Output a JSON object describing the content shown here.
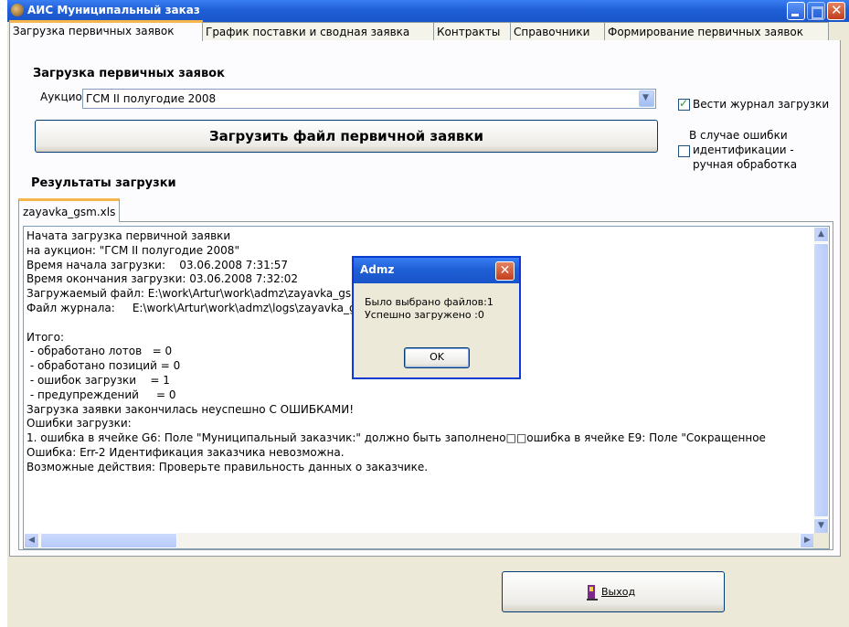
{
  "window": {
    "title": "АИС Муниципальный заказ"
  },
  "tabs": [
    {
      "label": "Загрузка первичных заявок",
      "active": true
    },
    {
      "label": "График поставки и сводная заявка",
      "active": false
    },
    {
      "label": "Контракты",
      "active": false
    },
    {
      "label": "Справочники",
      "active": false
    },
    {
      "label": "Формирование первичных заявок",
      "active": false
    }
  ],
  "upload": {
    "section_title": "Загрузка первичных заявок",
    "auction_label": "Аукцион:",
    "auction_value": "ГСМ II полугодие 2008",
    "log_checkbox_label": "Вести журнал загрузки",
    "log_checkbox_checked": true,
    "manual_label_1": "В случае ошибки",
    "manual_label_2": "идентификации -",
    "manual_label_3": "ручная обработка",
    "manual_checkbox_checked": false,
    "upload_button": "Загрузить файл первичной заявки"
  },
  "results": {
    "section_title": "Результаты загрузки",
    "file_tab": "zayavka_gsm.xls",
    "lines": [
      "Начата загрузка первичной заявки",
      "на аукцион: \"ГСМ II полугодие 2008\"",
      "Время начала загрузки:    03.06.2008 7:31:57",
      "Время окончания загрузки: 03.06.2008 7:32:02",
      "Загружаемый файл: E:\\work\\Artur\\work\\admz\\zayavka_gsm.xls",
      "Файл журнала:     E:\\work\\Artur\\work\\admz\\logs\\zayavka_gsm.log",
      "",
      "Итого:",
      " - обработано лотов   = 0",
      " - обработано позиций = 0",
      " - ошибок загрузки    = 1",
      " - предупреждений     = 0",
      "Загрузка заявки закончилась неуспешно С ОШИБКАМИ!",
      "Ошибки загрузки:",
      "1. ошибка в ячейке G6: Поле \"Муниципальный заказчик:\" должно быть заполнено□□ошибка в ячейке E9: Поле \"Сокращенное",
      "Ошибка: Err-2 Идентификация заказчика невозможна.",
      "Возможные действия: Проверьте правильность данных о заказчике."
    ]
  },
  "dialog": {
    "title": "Admz",
    "message": "Было выбрано файлов:1\nУспешно загружено :0",
    "ok_label": "OK"
  },
  "exit_button": "Выход"
}
